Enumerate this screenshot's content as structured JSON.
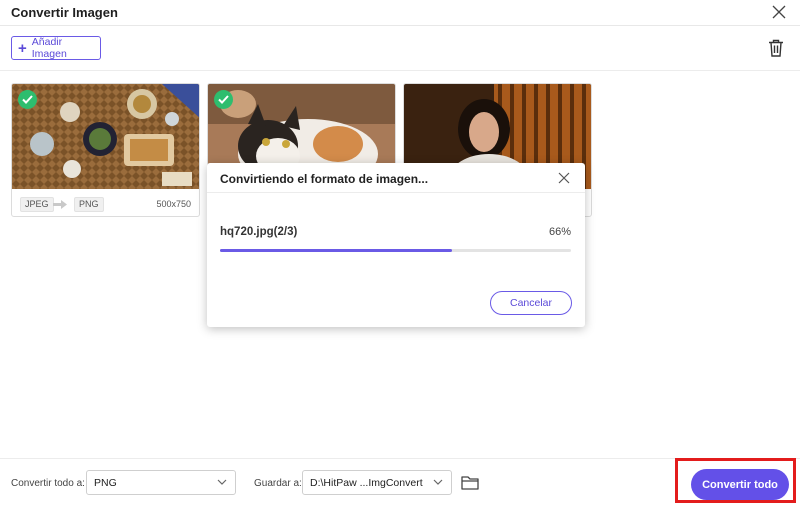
{
  "window": {
    "title": "Convertir Imagen"
  },
  "toolbar": {
    "add_label": "Añadir Imagen"
  },
  "cards": [
    {
      "from": "JPEG",
      "to": "PNG",
      "dims": "500x750",
      "checked": true
    },
    {
      "checked": true
    },
    {
      "checked": false
    }
  ],
  "dialog": {
    "title": "Convirtiendo el formato de imagen...",
    "file": "hq720.jpg(2/3)",
    "percent_label": "66%",
    "progress": 0.66,
    "cancel_label": "Cancelar"
  },
  "footer": {
    "convert_all_label": "Convertir todo a:",
    "format_value": "PNG",
    "save_label": "Guardar a:",
    "save_path": "D:\\HitPaw ...ImgConvert",
    "convert_button": "Convertir todo"
  },
  "colors": {
    "accent": "#6350e8",
    "check": "#2ebd6e",
    "highlight": "#e31c1c"
  },
  "icons": [
    "close-icon",
    "plus-icon",
    "trash-icon",
    "check-icon",
    "arrow-right-icon",
    "chevron-down-icon",
    "folder-icon"
  ]
}
